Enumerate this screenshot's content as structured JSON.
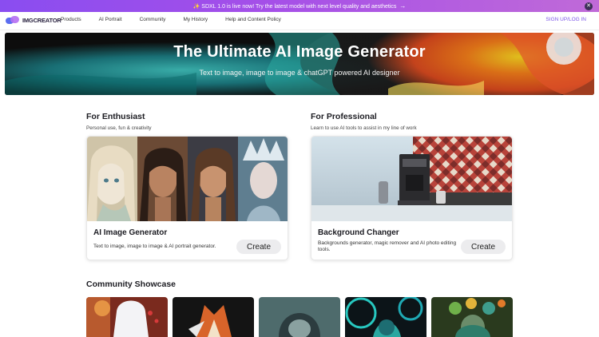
{
  "announcement": {
    "text": "✨ SDXL 1.0 is live now! Try the latest model with next level quality and aesthetics",
    "arrow_icon": "arrow-right-icon",
    "close_icon": "close-icon"
  },
  "nav": {
    "logo": "IMGCREATOR",
    "links": [
      "Products",
      "AI Portrait",
      "Community",
      "My History",
      "Help and Content Policy"
    ],
    "signup": "SIGN UP/LOG IN"
  },
  "hero": {
    "title": "The Ultimate AI Image Generator",
    "subtitle": "Text to image, image to image & chatGPT powered AI designer"
  },
  "enthusiast": {
    "heading": "For Enthusiast",
    "subheading": "Personal use, fun & creativity",
    "card_title": "AI Image Generator",
    "card_desc": "Text to image, image to image & AI portrait generator.",
    "button": "Create"
  },
  "professional": {
    "heading": "For Professional",
    "subheading": "Learn to use AI tools to assist in my line of work",
    "card_title": "Background Changer",
    "card_desc": "Backgrounds generator, magic remover and AI photo editing tools.",
    "button": "Create"
  },
  "showcase": {
    "title": "Community Showcase"
  },
  "colors": {
    "accent": "#7b55e8",
    "banner_start": "#8a4df0",
    "banner_end": "#c06ad8"
  }
}
